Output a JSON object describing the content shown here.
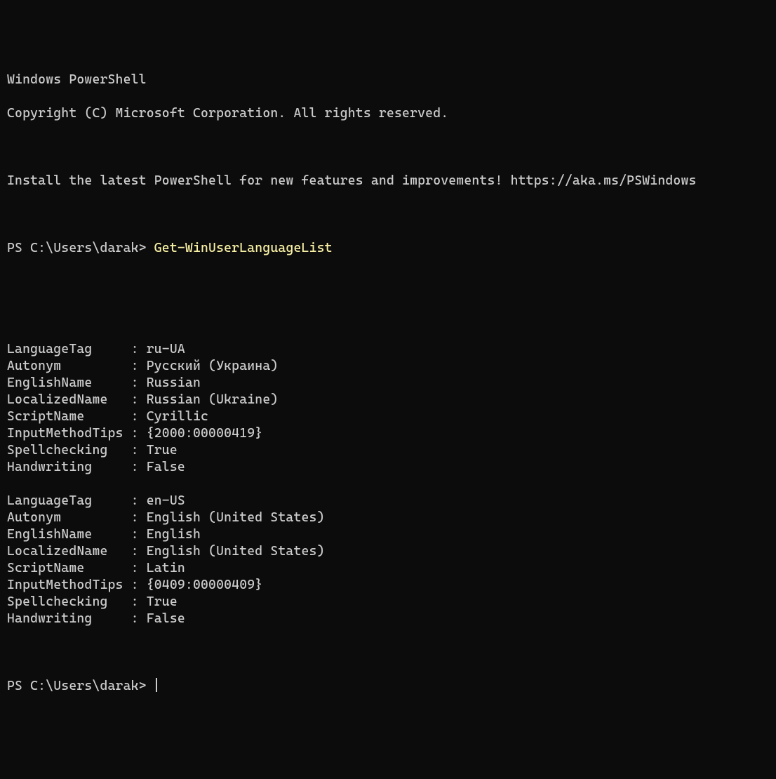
{
  "header": {
    "line1": "Windows PowerShell",
    "line2": "Copyright (C) Microsoft Corporation. All rights reserved.",
    "line3": "Install the latest PowerShell for new features and improvements! https://aka.ms/PSWindows"
  },
  "prompt1": {
    "prefix": "PS C:\\Users\\darak> ",
    "command": "Get-WinUserLanguageList"
  },
  "results": [
    {
      "LanguageTag": "ru-UA",
      "Autonym": "Русский (Украина)",
      "EnglishName": "Russian",
      "LocalizedName": "Russian (Ukraine)",
      "ScriptName": "Cyrillic",
      "InputMethodTips": "{2000:00000419}",
      "Spellchecking": "True",
      "Handwriting": "False"
    },
    {
      "LanguageTag": "en-US",
      "Autonym": "English (United States)",
      "EnglishName": "English",
      "LocalizedName": "English (United States)",
      "ScriptName": "Latin",
      "InputMethodTips": "{0409:00000409}",
      "Spellchecking": "True",
      "Handwriting": "False"
    }
  ],
  "keys_order": [
    "LanguageTag",
    "Autonym",
    "EnglishName",
    "LocalizedName",
    "ScriptName",
    "InputMethodTips",
    "Spellchecking",
    "Handwriting"
  ],
  "key_column_width": 16,
  "prompt2": {
    "prefix": "PS C:\\Users\\darak> "
  }
}
